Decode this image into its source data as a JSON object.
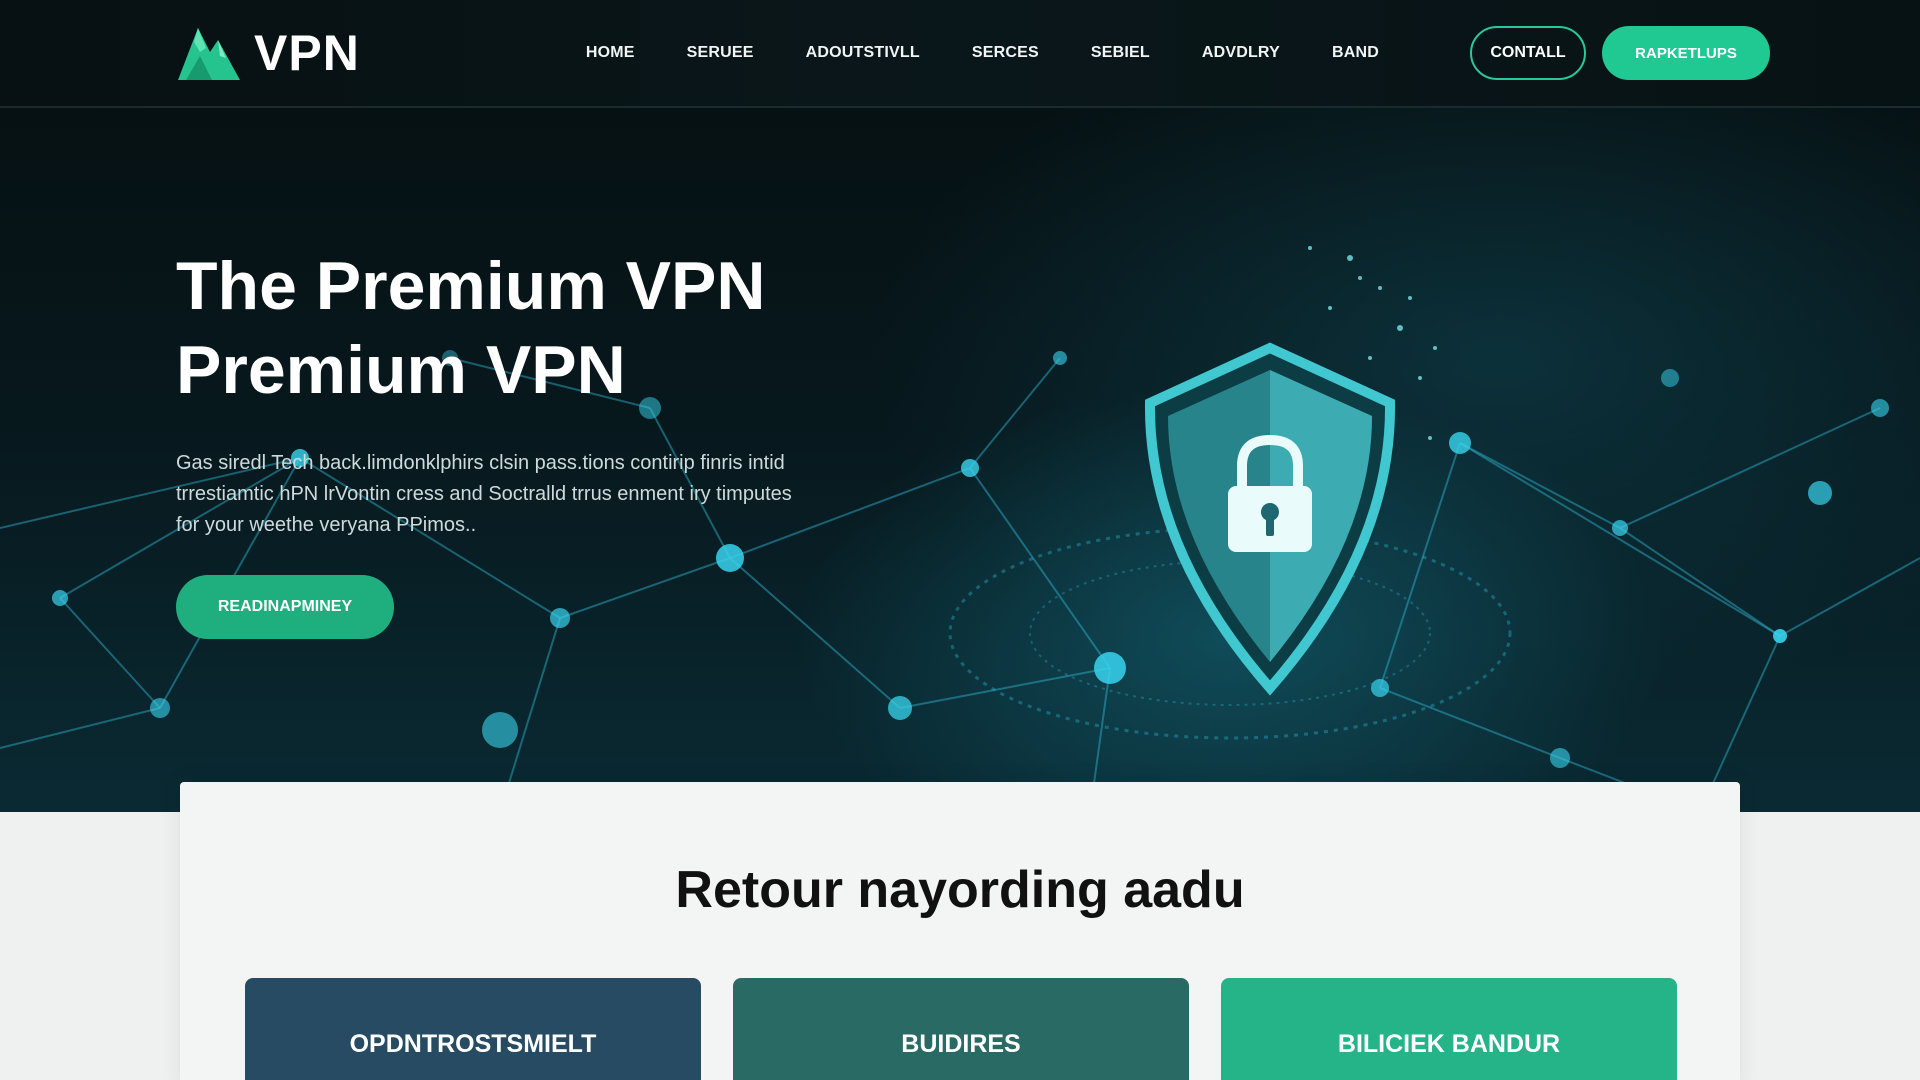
{
  "brand": {
    "name": "VPN",
    "logo_icon": "mountain-logo-icon"
  },
  "nav": {
    "links": [
      "HOME",
      "SERUEE",
      "ADOUTSTIVLL",
      "SERCES",
      "SEBIEL",
      "ADVDLRY",
      "BAND"
    ],
    "contact_label": "CONTALL",
    "primary_label": "RAPKETLUPS"
  },
  "hero": {
    "title_line1": "The Premium VPN",
    "title_line2": "Premium VPN",
    "description": "Gas siredl Tech back.limdonklphirs clsin pass.tions contirip finris intid trrestiamtic hPN lrVontin cress and Soctralld trrus enment iry timputes for your weethe veryana PPimos..",
    "cta_label": "READINAPMINEY",
    "illustration_icon": "shield-lock-icon"
  },
  "section": {
    "title": "Retour nayording aadu",
    "cards": [
      "OPDNTROSTSMIELT",
      "BUIDIRES",
      "BILICIEK BANDUR"
    ]
  },
  "colors": {
    "accent": "#21c992",
    "nav_bg": "#081416",
    "card_blue": "#274b62",
    "card_teal": "#2a6a64",
    "card_green": "#25b487"
  }
}
